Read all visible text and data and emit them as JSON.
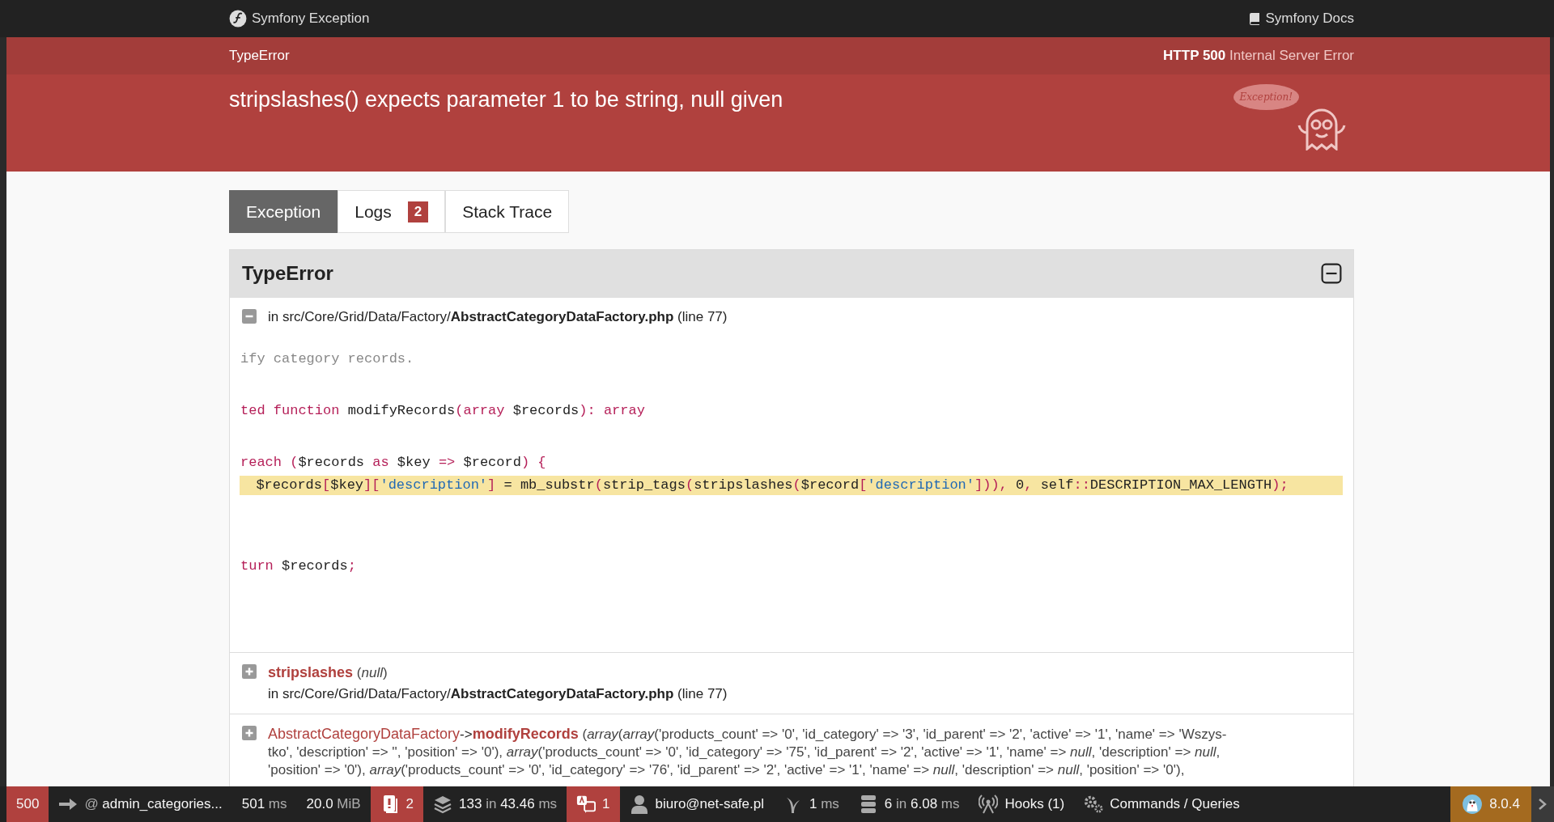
{
  "topbar": {
    "brand": "Symfony Exception",
    "docs": "Symfony Docs"
  },
  "header": {
    "exception_class": "TypeError",
    "status_code": "HTTP 500",
    "status_text": "Internal Server Error",
    "message": "stripslashes() expects parameter 1 to be string, null given",
    "bubble": "Exception!"
  },
  "tabs": [
    {
      "label": "Exception",
      "selected": true
    },
    {
      "label": "Logs",
      "badge": "2",
      "selected": false
    },
    {
      "label": "Stack Trace",
      "selected": false
    }
  ],
  "exception": {
    "title": "TypeError",
    "expanded": true,
    "frames": [
      {
        "kind": "file",
        "expanded": true,
        "location": "in src/Core/Grid/Data/Factory/**AbstractCategoryDataFactory.php** (line 77)",
        "code": [
          {
            "highlighted": false,
            "tokens": [
              {
                "text": "ify category records.",
                "color": "#888888"
              }
            ]
          },
          {
            "highlighted": false
          },
          {
            "highlighted": false,
            "tokens": [
              {
                "text": "ted ",
                "color": "#b51f58"
              },
              {
                "text": "function ",
                "color": "#b51f58"
              },
              {
                "text": "modifyRecords",
                "color": "#222222"
              },
              {
                "text": "(",
                "color": "#b51f58"
              },
              {
                "text": "array ",
                "color": "#b51f58"
              },
              {
                "text": "$records",
                "color": "#222222"
              },
              {
                "text": "): ",
                "color": "#b51f58"
              },
              {
                "text": "array",
                "color": "#b51f58"
              }
            ]
          },
          {
            "highlighted": false
          },
          {
            "highlighted": false,
            "tokens": [
              {
                "text": "reach ",
                "color": "#b51f58"
              },
              {
                "text": "(",
                "color": "#b51f58"
              },
              {
                "text": "$records ",
                "color": "#222222"
              },
              {
                "text": "as ",
                "color": "#b51f58"
              },
              {
                "text": "$key ",
                "color": "#222222"
              },
              {
                "text": "=> ",
                "color": "#b51f58"
              },
              {
                "text": "$record",
                "color": "#222222"
              },
              {
                "text": ") {",
                "color": "#b51f58"
              }
            ]
          },
          {
            "highlighted": true,
            "tokens": [
              {
                "text": "  $records",
                "color": "#222222"
              },
              {
                "text": "[",
                "color": "#b51f58"
              },
              {
                "text": "$key",
                "color": "#222222"
              },
              {
                "text": "][",
                "color": "#b51f58"
              },
              {
                "text": "'description'",
                "color": "#2169b5"
              },
              {
                "text": "]",
                "color": "#b51f58"
              },
              {
                "text": " = mb_substr",
                "color": "#222222"
              },
              {
                "text": "(",
                "color": "#b51f58"
              },
              {
                "text": "strip_tags",
                "color": "#222222"
              },
              {
                "text": "(",
                "color": "#b51f58"
              },
              {
                "text": "stripslashes",
                "color": "#222222"
              },
              {
                "text": "(",
                "color": "#b51f58"
              },
              {
                "text": "$record",
                "color": "#222222"
              },
              {
                "text": "[",
                "color": "#b51f58"
              },
              {
                "text": "'description'",
                "color": "#2169b5"
              },
              {
                "text": "])), ",
                "color": "#b51f58"
              },
              {
                "text": "0",
                "color": "#222222"
              },
              {
                "text": ", ",
                "color": "#b51f58"
              },
              {
                "text": "self",
                "color": "#222222"
              },
              {
                "text": "::",
                "color": "#b51f58"
              },
              {
                "text": "DESCRIPTION_MAX_LENGTH",
                "color": "#222222"
              },
              {
                "text": ");",
                "color": "#b51f58"
              }
            ]
          },
          {
            "highlighted": false
          },
          {
            "highlighted": false
          },
          {
            "highlighted": false,
            "tokens": [
              {
                "text": "turn ",
                "color": "#b51f58"
              },
              {
                "text": "$records",
                "color": "#222222"
              },
              {
                "text": ";",
                "color": "#b51f58"
              }
            ]
          }
        ]
      },
      {
        "kind": "call",
        "expanded": false,
        "function": "stripslashes",
        "args": "(*null*)",
        "location": "in src/Core/Grid/Data/Factory/**AbstractCategoryDataFactory.php** (line 77)"
      },
      {
        "kind": "method",
        "expanded": false,
        "class": "AbstractCategoryDataFactory",
        "arrow": "->",
        "function": "modifyRecords",
        "args_lines": [
          "(*array*(*array*('products_count' => '0', 'id_category' => '3', 'id_parent' => '2', 'active' => '1', 'name' => 'Wszys-",
          "tko', 'description' => '', 'position' => '0'), *array*('products_count' => '0', 'id_category' => '75', 'id_parent' => '2', 'active' => '1', 'name' => *null*, 'description' => *null*,",
          "'position' => '0'), *array*('products_count' => '0', 'id_category' => '76', 'id_parent' => '2', 'active' => '1', 'name' => *null*, 'description' => *null*, 'position' => '0'),"
        ]
      }
    ]
  },
  "toolbar": [
    {
      "kind": "status",
      "color": "#b0413e",
      "parts": [
        {
          "text": "500",
          "muted": false
        }
      ]
    },
    {
      "kind": "route",
      "color": "#222222",
      "parts": [
        {
          "text": "@ ",
          "muted": true
        },
        {
          "text": "admin_categories...",
          "muted": false
        }
      ]
    },
    {
      "kind": "time",
      "color": "#222222",
      "parts": [
        {
          "text": "501",
          "muted": false
        },
        {
          "text": " ms",
          "muted": true
        }
      ]
    },
    {
      "kind": "memory",
      "color": "#222222",
      "parts": [
        {
          "text": "20.0",
          "muted": false
        },
        {
          "text": " MiB",
          "muted": true
        }
      ]
    },
    {
      "kind": "logger",
      "color": "#b0413e",
      "parts": [
        {
          "text": "2",
          "muted": false
        }
      ]
    },
    {
      "kind": "events",
      "color": "#222222",
      "parts": [
        {
          "text": "133",
          "muted": false
        },
        {
          "text": " in ",
          "muted": true
        },
        {
          "text": "43.46",
          "muted": false
        },
        {
          "text": " ms",
          "muted": true
        }
      ]
    },
    {
      "kind": "translation",
      "color": "#b0413e",
      "parts": [
        {
          "text": "1",
          "muted": false
        }
      ]
    },
    {
      "kind": "security",
      "color": "#222222",
      "parts": [
        {
          "text": "biuro@net-safe.pl",
          "muted": false
        }
      ]
    },
    {
      "kind": "twig",
      "color": "#222222",
      "parts": [
        {
          "text": "1",
          "muted": false
        },
        {
          "text": " ms",
          "muted": true
        }
      ]
    },
    {
      "kind": "database",
      "color": "#222222",
      "parts": [
        {
          "text": "6",
          "muted": false
        },
        {
          "text": " in ",
          "muted": true
        },
        {
          "text": "6.08",
          "muted": false
        },
        {
          "text": " ms",
          "muted": true
        }
      ]
    },
    {
      "kind": "hooks",
      "color": "#222222",
      "parts": [
        {
          "text": "Hooks (1)",
          "muted": false
        }
      ]
    },
    {
      "kind": "commands",
      "color": "#222222",
      "parts": [
        {
          "text": "Commands / Queries",
          "muted": false
        }
      ]
    },
    {
      "kind": "version",
      "color": "#a46a1f",
      "parts": [
        {
          "text": "8.0.4",
          "muted": false
        }
      ]
    }
  ]
}
